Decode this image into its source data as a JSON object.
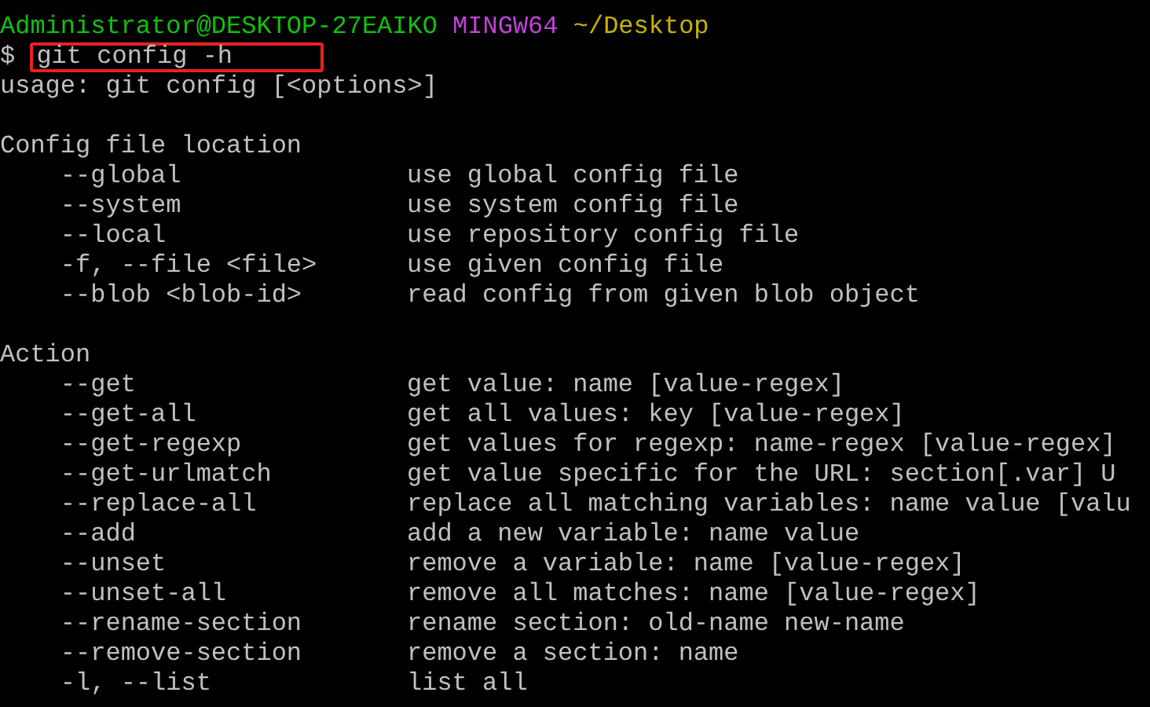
{
  "prompt": {
    "user_host": "Administrator@DESKTOP-27EAIKO",
    "shell": "MINGW64",
    "path": "~/Desktop",
    "symbol": "$"
  },
  "command": {
    "text": "git config -h",
    "highlighted": true
  },
  "usage": "usage: git config [<options>]",
  "sections": [
    {
      "title": "Config file location",
      "options": [
        {
          "flag": "--global",
          "description": "use global config file"
        },
        {
          "flag": "--system",
          "description": "use system config file"
        },
        {
          "flag": "--local",
          "description": "use repository config file"
        },
        {
          "flag": "-f, --file <file>",
          "description": "use given config file"
        },
        {
          "flag": "--blob <blob-id>",
          "description": "read config from given blob object"
        }
      ]
    },
    {
      "title": "Action",
      "options": [
        {
          "flag": "--get",
          "description": "get value: name [value-regex]"
        },
        {
          "flag": "--get-all",
          "description": "get all values: key [value-regex]"
        },
        {
          "flag": "--get-regexp",
          "description": "get values for regexp: name-regex [value-regex]"
        },
        {
          "flag": "--get-urlmatch",
          "description": "get value specific for the URL: section[.var] U"
        },
        {
          "flag": "--replace-all",
          "description": "replace all matching variables: name value [valu"
        },
        {
          "flag": "--add",
          "description": "add a new variable: name value"
        },
        {
          "flag": "--unset",
          "description": "remove a variable: name [value-regex]"
        },
        {
          "flag": "--unset-all",
          "description": "remove all matches: name [value-regex]"
        },
        {
          "flag": "--rename-section",
          "description": "rename section: old-name new-name"
        },
        {
          "flag": "--remove-section",
          "description": "remove a section: name"
        },
        {
          "flag": "-l, --list",
          "description": "list all"
        }
      ]
    }
  ]
}
